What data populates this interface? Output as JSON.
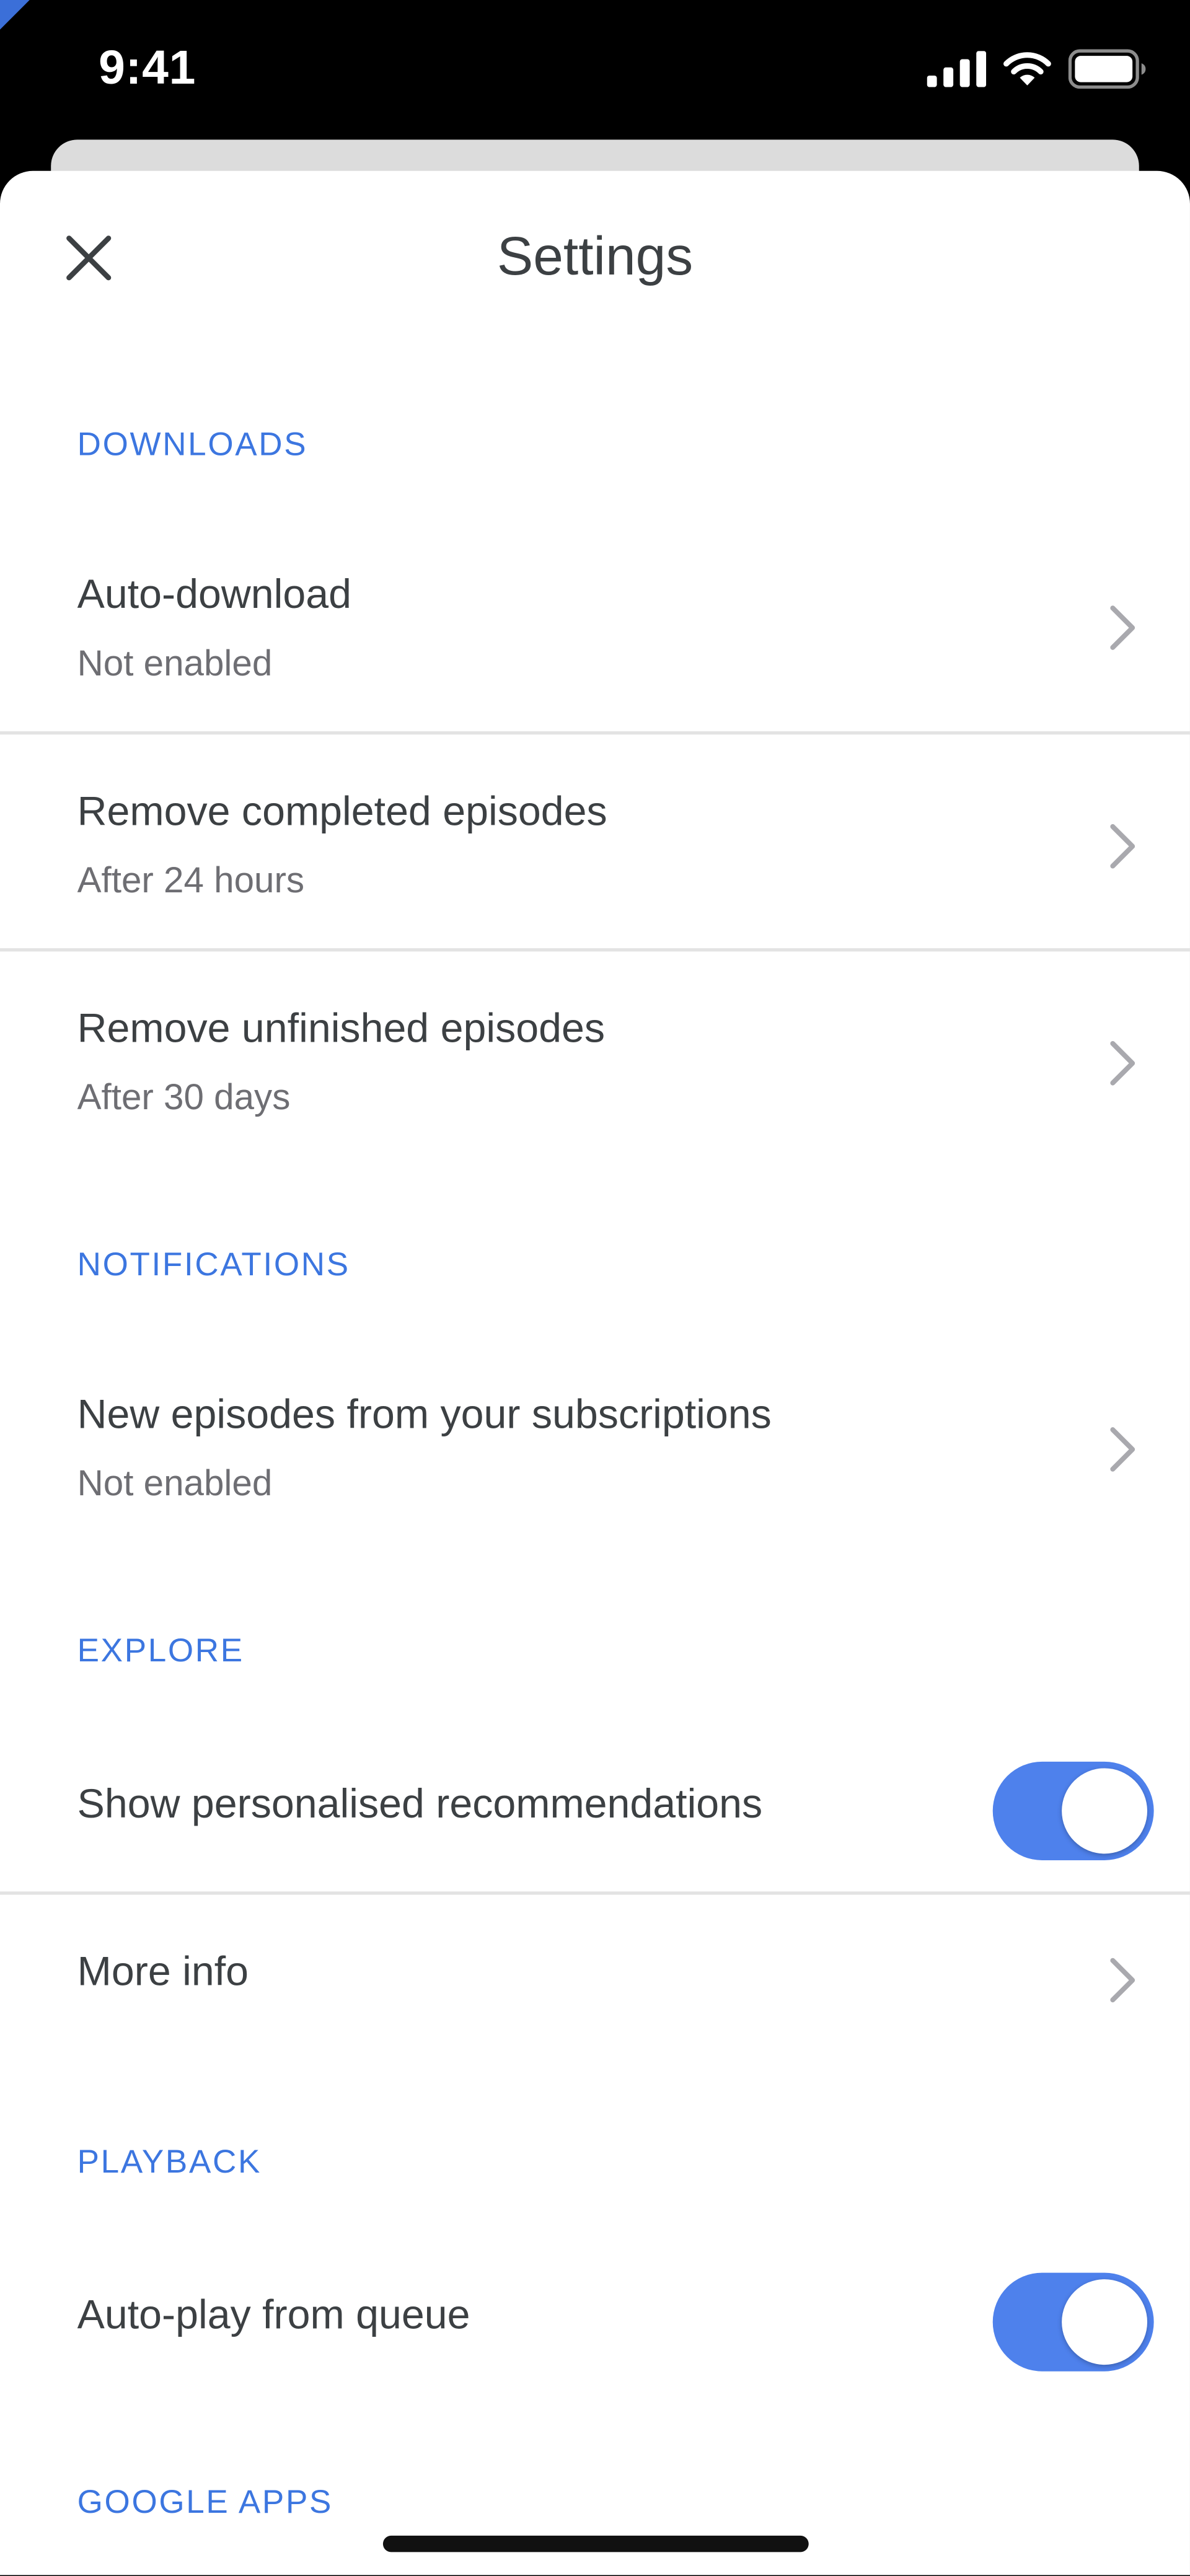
{
  "status_bar": {
    "time": "9:41"
  },
  "header": {
    "title": "Settings",
    "close_icon": "close-icon"
  },
  "colors": {
    "accent": "#4e81ec",
    "section_title": "#3c76e0",
    "text": "#3c4043",
    "subtext": "#6e6e73"
  },
  "sections": {
    "downloads": {
      "title": "DOWNLOADS",
      "items": [
        {
          "title": "Auto-download",
          "subtitle": "Not enabled"
        },
        {
          "title": "Remove completed episodes",
          "subtitle": "After 24 hours"
        },
        {
          "title": "Remove unfinished episodes",
          "subtitle": "After 30 days"
        }
      ]
    },
    "notifications": {
      "title": "NOTIFICATIONS",
      "items": [
        {
          "title": "New episodes from your subscriptions",
          "subtitle": "Not enabled"
        }
      ]
    },
    "explore": {
      "title": "EXPLORE",
      "items": [
        {
          "title": "Show personalised recommendations",
          "toggle_on": true
        },
        {
          "title": "More info"
        }
      ]
    },
    "playback": {
      "title": "PLAYBACK",
      "items": [
        {
          "title": "Auto-play from queue",
          "toggle_on": true
        }
      ]
    },
    "google_apps": {
      "title": "GOOGLE APPS"
    }
  }
}
